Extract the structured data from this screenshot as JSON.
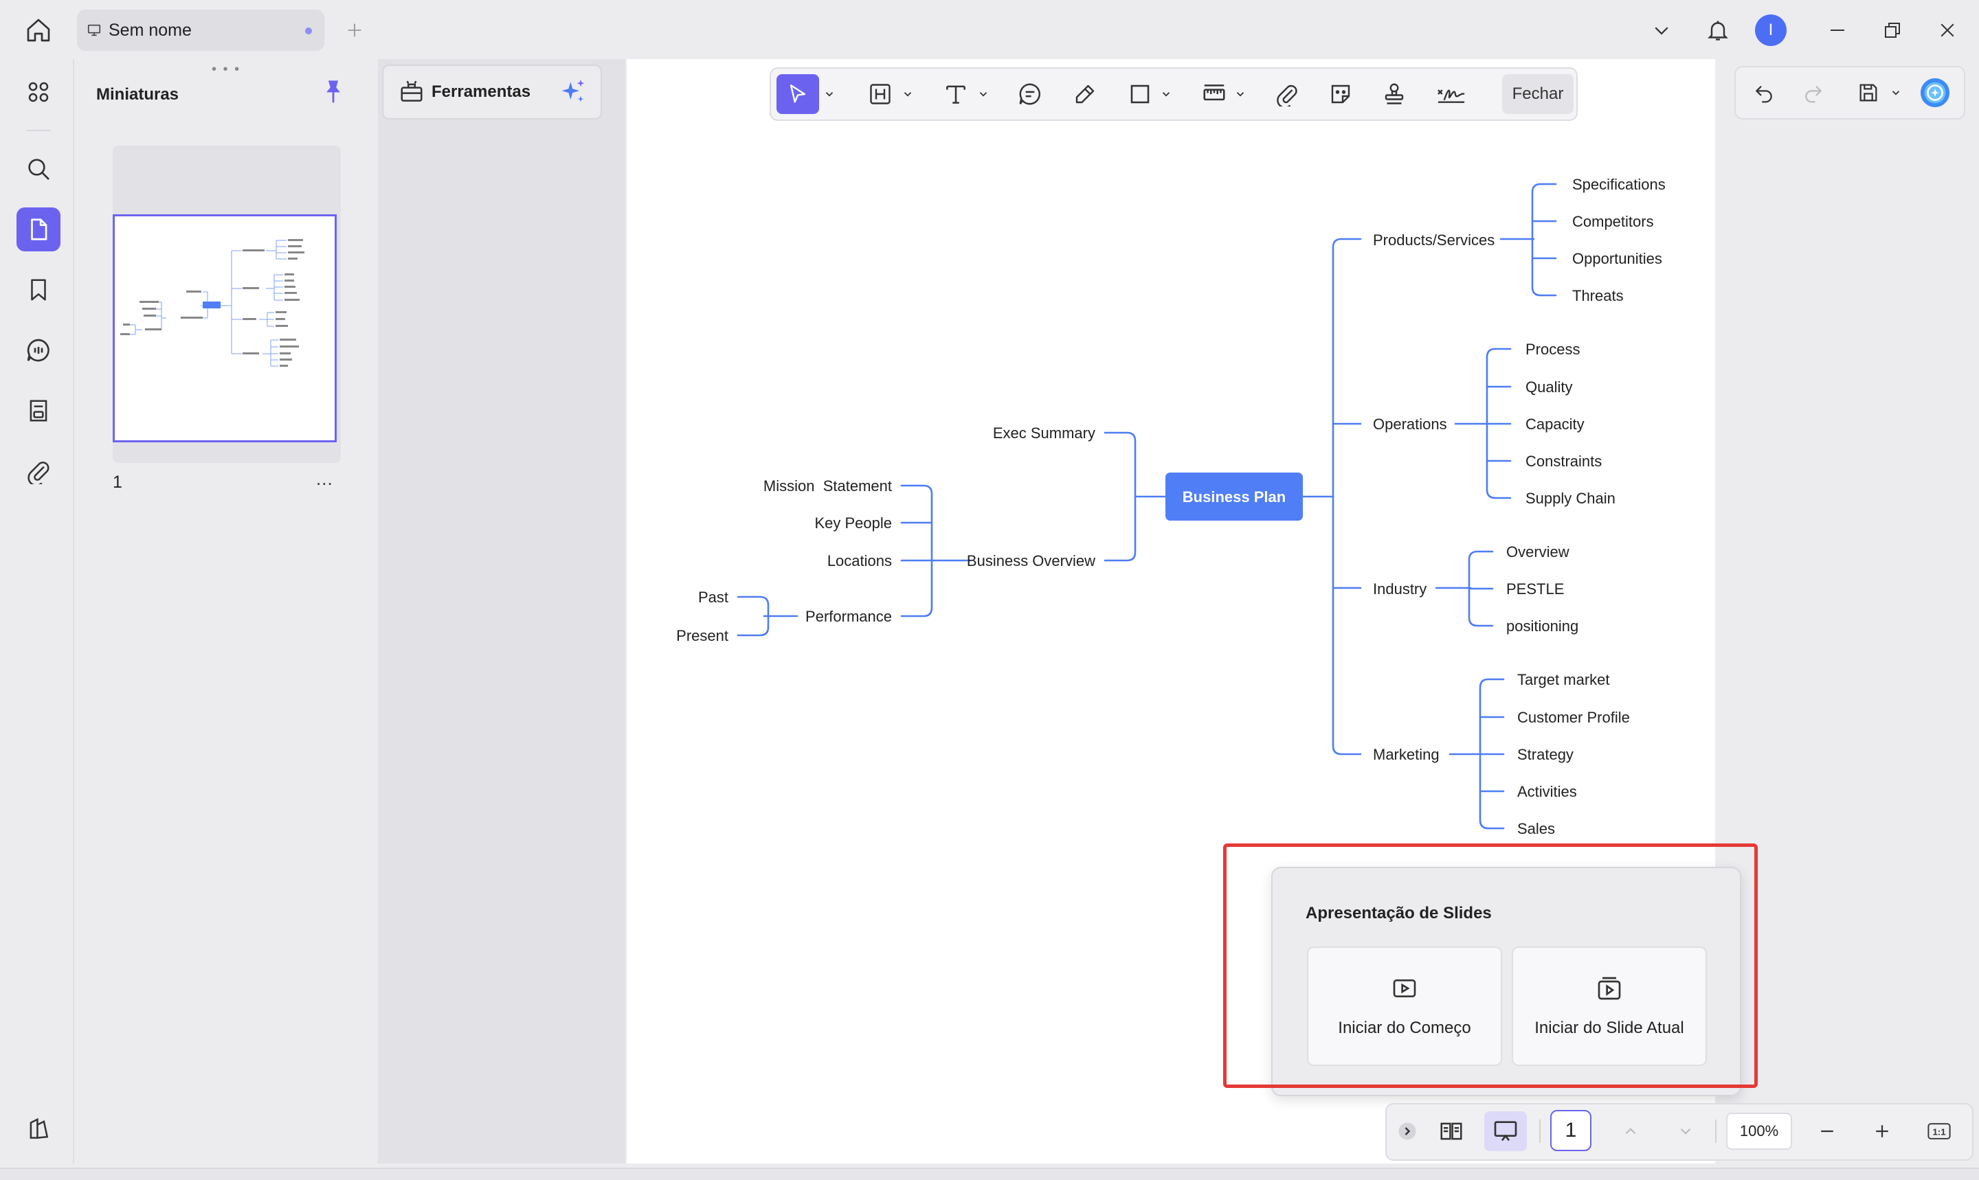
{
  "tab": {
    "title": "Sem nome"
  },
  "account": {
    "initial": "I"
  },
  "thumbnails": {
    "title": "Miniaturas",
    "page_number": "1",
    "more": "..."
  },
  "tools_panel": {
    "label": "Ferramentas"
  },
  "toolbar": {
    "close_label": "Fechar"
  },
  "mindmap": {
    "root": "Business Plan",
    "left": {
      "exec_summary": "Exec Summary",
      "business_overview": "Business Overview",
      "mission_statement": "Mission  Statement",
      "key_people": "Key People",
      "locations": "Locations",
      "performance": "Performance",
      "past": "Past",
      "present": "Present"
    },
    "right": {
      "products_services": "Products/Services",
      "specifications": "Specifications",
      "competitors": "Competitors",
      "opportunities": "Opportunities",
      "threats": "Threats",
      "operations": "Operations",
      "process": "Process",
      "quality": "Quality",
      "capacity": "Capacity",
      "constraints": "Constraints",
      "supply_chain": "Supply Chain",
      "industry": "Industry",
      "overview": "Overview",
      "pestle": "PESTLE",
      "positioning": "positioning",
      "marketing": "Marketing",
      "target_market": "Target market",
      "customer_profile": "Customer Profile",
      "strategy": "Strategy",
      "activities": "Activities",
      "sales": "Sales"
    }
  },
  "slideshow": {
    "title": "Apresentação de Slides",
    "start_beginning": "Iniciar do Começo",
    "start_current": "Iniciar do Slide Atual"
  },
  "bottom": {
    "page": "1",
    "zoom": "100%",
    "fit_label": "1:1"
  },
  "colors": {
    "accent": "#6b63f0",
    "mindmap_line": "#4d7cf5",
    "root_fill": "#4f7ef7",
    "highlight": "#e53935"
  }
}
